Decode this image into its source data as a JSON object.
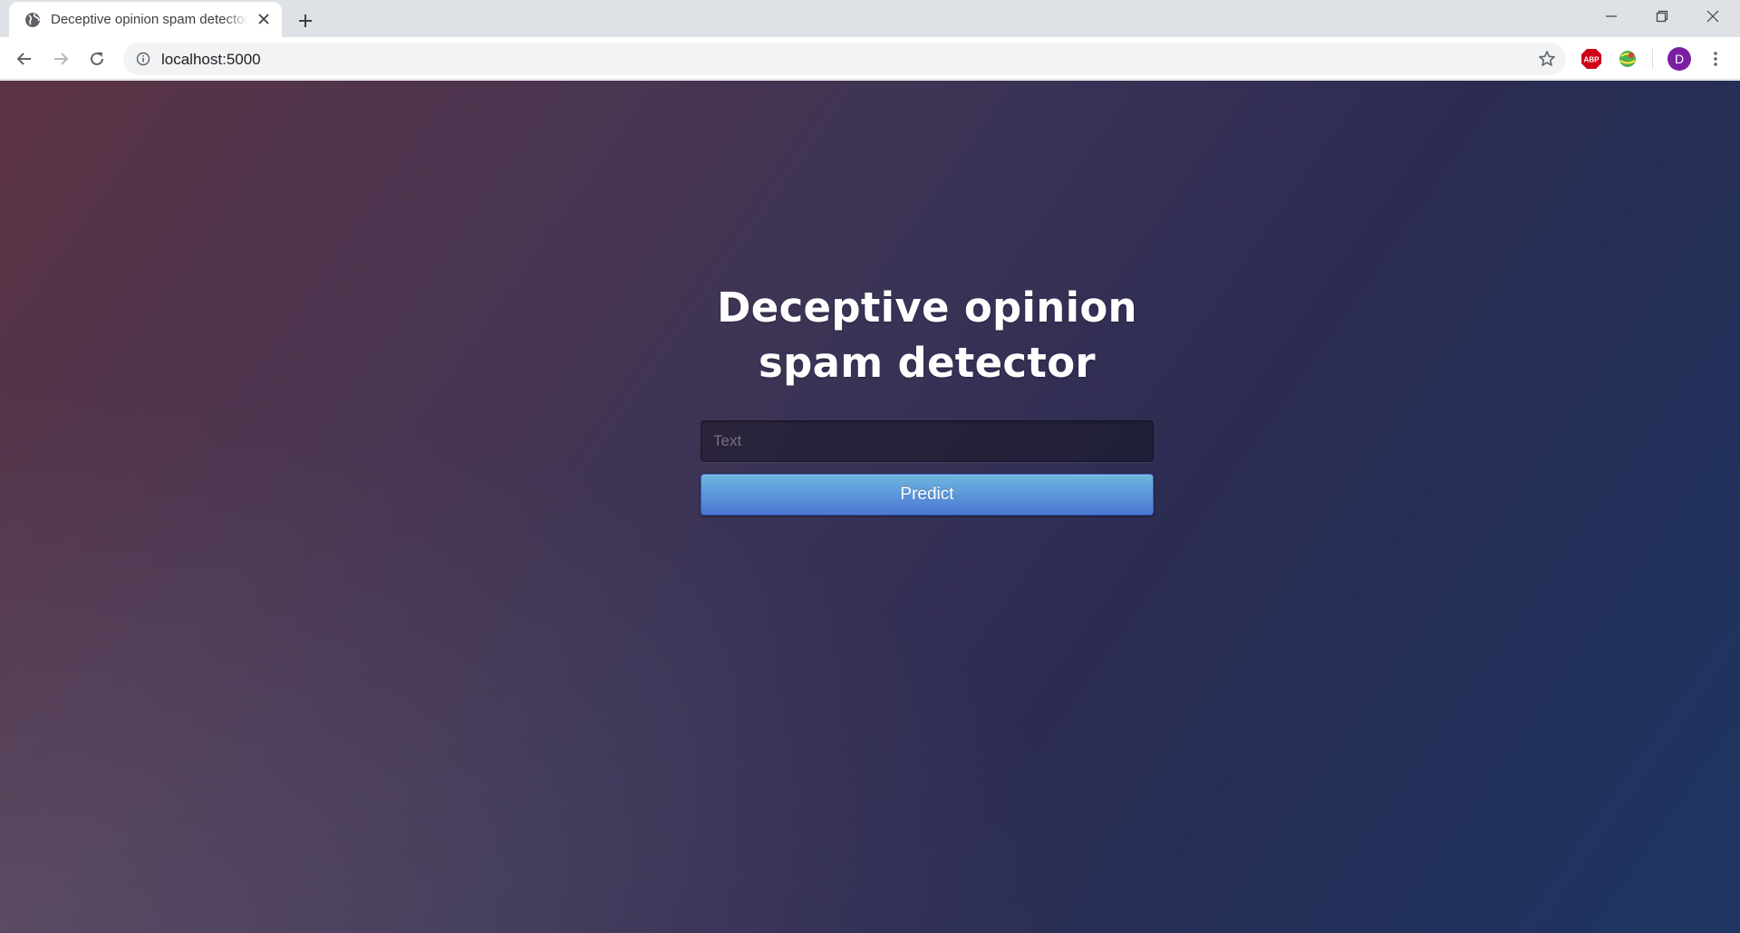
{
  "browser": {
    "tab": {
      "title": "Deceptive opinion spam detector",
      "favicon": "globe-icon",
      "close_icon": "close-icon"
    },
    "new_tab_icon": "plus-icon",
    "window_controls": [
      "minimize-icon",
      "restore-icon",
      "close-icon"
    ],
    "nav": [
      "back-arrow-icon",
      "forward-arrow-icon",
      "reload-icon"
    ],
    "address": {
      "url": "localhost:5000",
      "site_info_icon": "info-icon",
      "bookmark_icon": "star-icon"
    },
    "extensions": [
      {
        "name": "adblock-plus-icon",
        "label": "ABP",
        "color": "#d0021b"
      },
      {
        "name": "globe-extension-icon",
        "color": "#4caf50"
      }
    ],
    "profile": {
      "initial": "D",
      "color": "#7b1fa2"
    },
    "menu_icon": "more-vert-icon"
  },
  "page": {
    "heading_line1": "Deceptive opinion",
    "heading_line2": "spam detector",
    "text_input": {
      "placeholder": "Text",
      "value": ""
    },
    "predict_button": {
      "label": "Predict",
      "color": "#4a77d4"
    },
    "background_colors": [
      "#5c3344",
      "#1e3563"
    ]
  }
}
